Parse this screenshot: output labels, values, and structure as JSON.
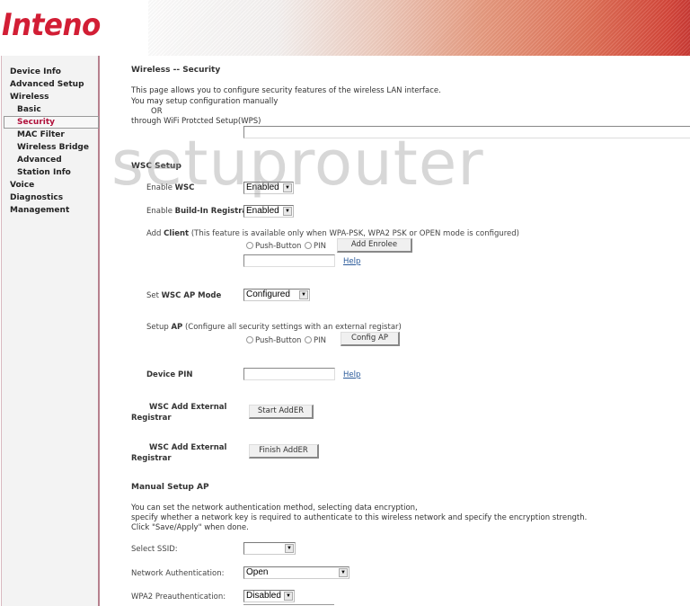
{
  "brand": {
    "logo_text": "Inteno",
    "accent_color": "#d21e35"
  },
  "sidebar": {
    "items": [
      {
        "label": "Device Info",
        "level": 0
      },
      {
        "label": "Advanced Setup",
        "level": 0
      },
      {
        "label": "Wireless",
        "level": 0
      },
      {
        "label": "Basic",
        "level": 1
      },
      {
        "label": "Security",
        "level": 1,
        "active": true
      },
      {
        "label": "MAC Filter",
        "level": 1
      },
      {
        "label": "Wireless Bridge",
        "level": 1
      },
      {
        "label": "Advanced",
        "level": 1
      },
      {
        "label": "Station Info",
        "level": 1
      },
      {
        "label": "Voice",
        "level": 0
      },
      {
        "label": "Diagnostics",
        "level": 0
      },
      {
        "label": "Management",
        "level": 0
      }
    ]
  },
  "watermark": "setuprouter",
  "page": {
    "title": "Wireless -- Security",
    "intro_line1": "This page allows you to configure security features of the wireless LAN interface.",
    "intro_line2": "You may setup configuration manually",
    "intro_or": "OR",
    "intro_line3": "through WiFi Protcted Setup(WPS)"
  },
  "wsc": {
    "heading": "WSC Setup",
    "enable_wsc": {
      "prefix": "Enable ",
      "bold": "WSC",
      "value": "Enabled"
    },
    "enable_registrar": {
      "prefix": "Enable ",
      "bold": "Build-In Registrar",
      "value": "Enabled"
    },
    "add_client": {
      "prefix": "Add ",
      "bold": "Client",
      "note": " (This feature is available only when WPA-PSK, WPA2 PSK or OPEN mode is configured)",
      "radio_push": "Push-Button",
      "radio_pin": "PIN",
      "button": "Add Enrolee",
      "pin_value": "",
      "help": "Help"
    },
    "ap_mode": {
      "prefix": "Set ",
      "bold": "WSC AP Mode",
      "value": "Configured"
    },
    "setup_ap": {
      "prefix": "Setup ",
      "bold": "AP",
      "note": " (Configure all security settings with an external registar)",
      "radio_push": "Push-Button",
      "radio_pin": "PIN",
      "button": "Config AP"
    },
    "device_pin": {
      "label": "Device PIN",
      "value": "",
      "help": "Help"
    },
    "external_registrar_1": {
      "line1": "WSC Add External",
      "line2": "Registrar",
      "button": "Start AddER"
    },
    "external_registrar_2": {
      "line1": "WSC Add External",
      "line2": "Registrar",
      "button": "Finish AddER"
    }
  },
  "manual": {
    "heading": "Manual Setup AP",
    "desc_line1": "You can set the network authentication method, selecting data encryption,",
    "desc_line2": "specify whether a network key is required to authenticate to this wireless network and specify the encryption strength.",
    "desc_line3": "Click \"Save/Apply\" when done.",
    "select_ssid": {
      "label": "Select SSID:",
      "value": ""
    },
    "network_auth": {
      "label": "Network Authentication:",
      "value": "Open"
    },
    "wpa2_preauth": {
      "label": "WPA2 Preauthentication:",
      "value": "Disabled"
    }
  }
}
